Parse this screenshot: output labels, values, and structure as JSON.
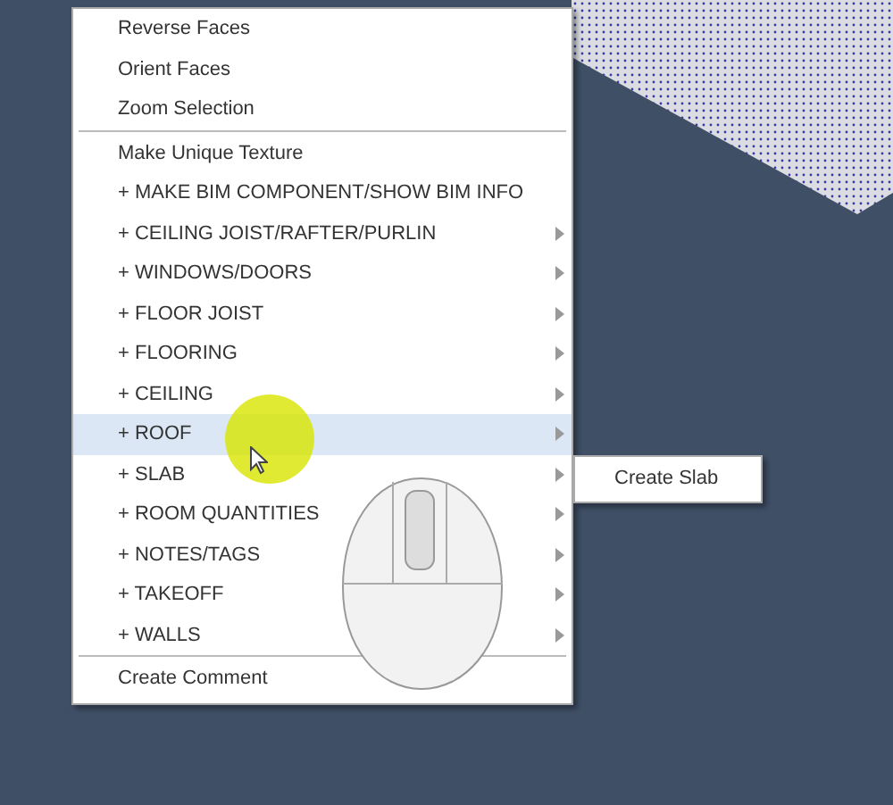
{
  "context_menu": {
    "sections": [
      {
        "items": [
          {
            "label": "Reverse Faces",
            "kind": "action",
            "selected": false
          },
          {
            "label": "Orient Faces",
            "kind": "action",
            "selected": false
          },
          {
            "label": "Zoom Selection",
            "kind": "action",
            "selected": false
          }
        ]
      },
      {
        "items": [
          {
            "label": "Make Unique Texture",
            "kind": "action",
            "selected": false
          },
          {
            "label": "+ MAKE BIM COMPONENT/SHOW BIM INFO",
            "kind": "action",
            "selected": false
          },
          {
            "label": "+ CEILING JOIST/RAFTER/PURLIN",
            "kind": "submenu",
            "selected": false
          },
          {
            "label": "+ WINDOWS/DOORS",
            "kind": "submenu",
            "selected": false
          },
          {
            "label": "+ FLOOR JOIST",
            "kind": "submenu",
            "selected": false
          },
          {
            "label": "+ FLOORING",
            "kind": "submenu",
            "selected": false
          },
          {
            "label": "+ CEILING",
            "kind": "submenu",
            "selected": false
          },
          {
            "label": "+ ROOF",
            "kind": "submenu",
            "selected": true
          },
          {
            "label": "+ SLAB",
            "kind": "submenu",
            "selected": false
          },
          {
            "label": "+ ROOM QUANTITIES",
            "kind": "submenu",
            "selected": false
          },
          {
            "label": "+ NOTES/TAGS",
            "kind": "submenu",
            "selected": false
          },
          {
            "label": "+ TAKEOFF",
            "kind": "submenu",
            "selected": false
          },
          {
            "label": "+ WALLS",
            "kind": "submenu",
            "selected": false
          }
        ]
      },
      {
        "items": [
          {
            "label": "Create Comment",
            "kind": "action",
            "selected": false
          }
        ]
      }
    ]
  },
  "submenu": {
    "items": [
      "Create Slab"
    ]
  }
}
